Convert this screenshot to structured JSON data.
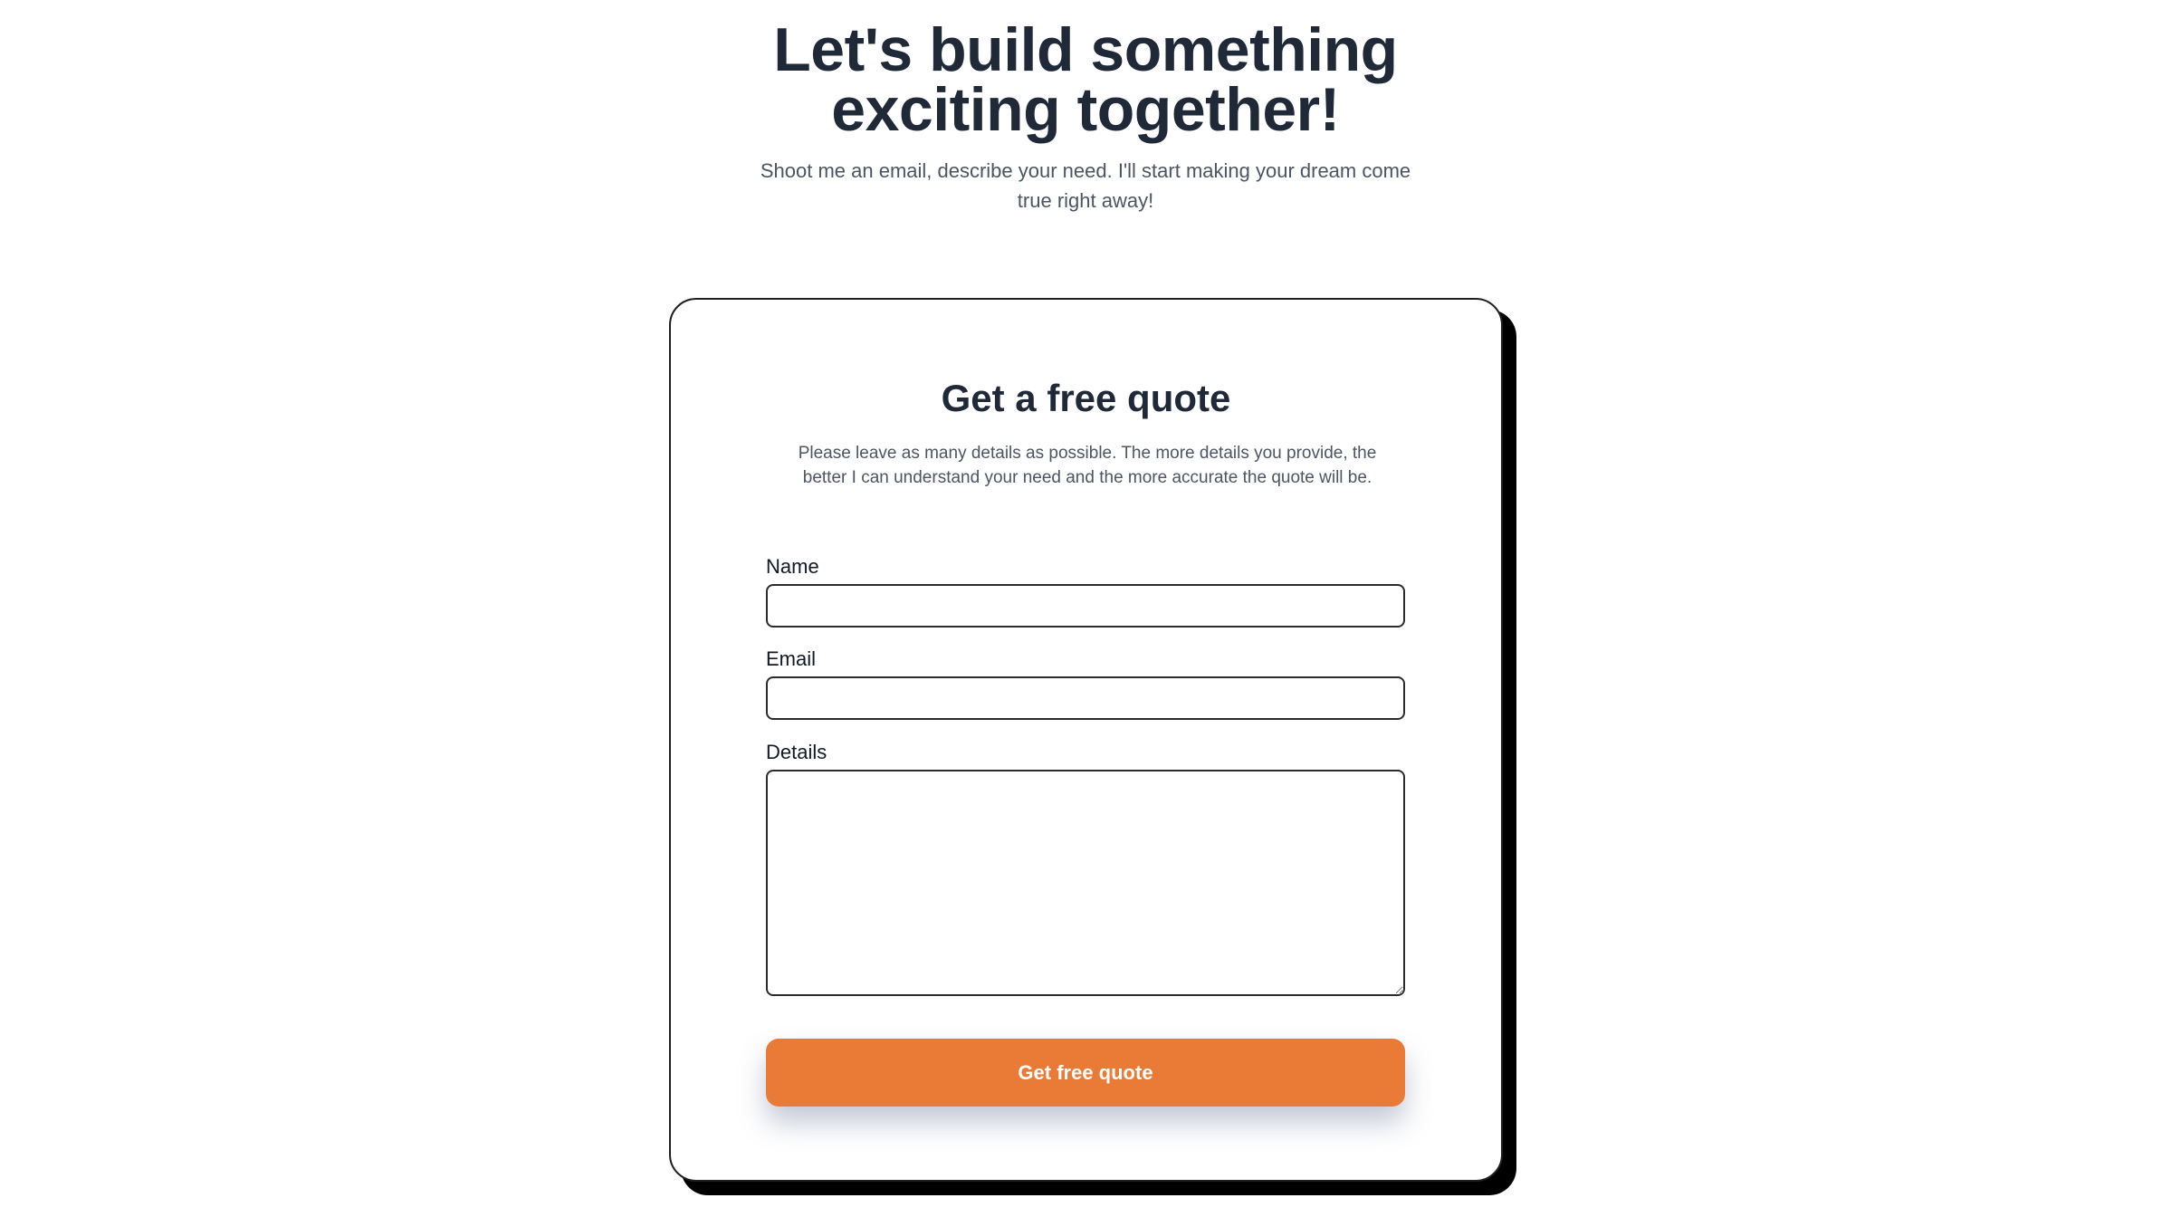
{
  "hero": {
    "title_line1": "Let's build something",
    "title_line2": "exciting together!",
    "subtitle": "Shoot me an email, describe your need. I'll start making your dream come true right away!"
  },
  "quote_form": {
    "title": "Get a free quote",
    "description": "Please leave as many details as possible. The more details you provide, the better I can understand your need and the more accurate the quote will be.",
    "fields": {
      "name": {
        "label": "Name",
        "value": "",
        "placeholder": ""
      },
      "email": {
        "label": "Email",
        "value": "",
        "placeholder": ""
      },
      "details": {
        "label": "Details",
        "value": "",
        "placeholder": ""
      }
    },
    "submit_label": "Get free quote"
  },
  "colors": {
    "accent": "#e97b37",
    "heading": "#1f2937",
    "body_text": "#4b5563",
    "card_shadow": "#000000"
  }
}
